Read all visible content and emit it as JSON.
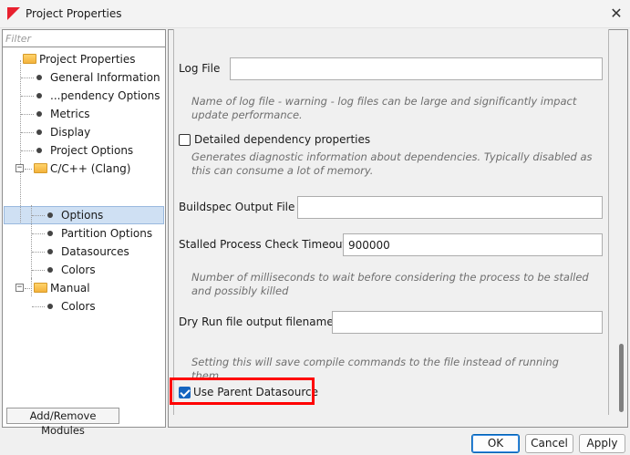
{
  "window": {
    "title": "Project Properties",
    "close_glyph": "✕"
  },
  "sidebar": {
    "filter_placeholder": "Filter",
    "tree": [
      {
        "label": "Project Properties",
        "icon": "folder-icon"
      },
      {
        "label": "General Information",
        "icon": "bullet-icon"
      },
      {
        "label": "...pendency Options",
        "icon": "bullet-icon"
      },
      {
        "label": "Metrics",
        "icon": "bullet-icon"
      },
      {
        "label": "Display",
        "icon": "bullet-icon"
      },
      {
        "label": "Project Options",
        "icon": "bullet-icon"
      },
      {
        "label": "C/C++ (Clang)",
        "icon": "folder-icon",
        "expander": "−"
      },
      {
        "label": "Options",
        "icon": "bullet-icon",
        "selected": true
      },
      {
        "label": "Partition Options",
        "icon": "bullet-icon"
      },
      {
        "label": "Datasources",
        "icon": "bullet-icon"
      },
      {
        "label": "Colors",
        "icon": "bullet-icon"
      },
      {
        "label": "Manual",
        "icon": "folder-icon",
        "expander": "−"
      },
      {
        "label": "Colors",
        "icon": "bullet-icon"
      }
    ],
    "add_remove_label": "Add/Remove Modules"
  },
  "options": {
    "log_file_label": "Log File",
    "log_file_value": "",
    "log_file_hint": "Name of log file - warning - log files can be large and significantly impact update performance.",
    "detailed_dep_label": "Detailed dependency properties",
    "detailed_dep_checked": false,
    "detailed_dep_hint": "Generates diagnostic information about dependencies. Typically disabled as this can consume a lot of memory.",
    "buildspec_label": "Buildspec Output File",
    "buildspec_value": "",
    "stalled_label": "Stalled Process Check Timeout",
    "stalled_value": "900000",
    "stalled_hint": "Number of milliseconds to wait before considering the process to be stalled and possibly killed",
    "dry_run_label": "Dry Run file output filename",
    "dry_run_value": "",
    "dry_run_hint": "Setting this will save compile commands to the file instead of running them.",
    "use_parent_label": "Use Parent Datasource",
    "use_parent_checked": true
  },
  "footer": {
    "ok_label": "OK",
    "cancel_label": "Cancel",
    "apply_label": "Apply"
  },
  "colors": {
    "accent": "#1565c0",
    "highlight": "#ff0000",
    "selection": "#cfe0f3"
  }
}
